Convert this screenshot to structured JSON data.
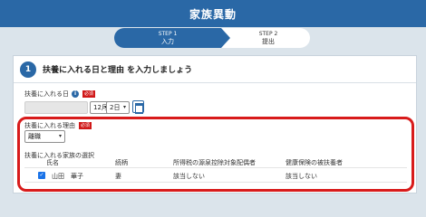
{
  "header": {
    "title": "家族異動"
  },
  "steps": [
    {
      "num": "STEP 1",
      "label": "入力"
    },
    {
      "num": "STEP 2",
      "label": "提出"
    }
  ],
  "section": {
    "number": "1",
    "title": "扶養に入れる日と理由 を入力しましょう"
  },
  "date_field": {
    "label": "扶養に入れる日",
    "required": "必須",
    "info": "i",
    "month": "12月",
    "day": "2日"
  },
  "reason_field": {
    "label": "扶養に入れる理由",
    "required": "必須",
    "value": "離職"
  },
  "family": {
    "label": "扶養に入れる家族の選択",
    "columns": [
      "氏名",
      "続柄",
      "所得税の源泉控除対象配偶者",
      "健康保険の被扶養者"
    ],
    "rows": [
      {
        "checked": "✓",
        "name": "山田　華子",
        "relation": "妻",
        "tax": "該当しない",
        "insurance": "該当しない"
      }
    ]
  },
  "colors": {
    "primary": "#2a68a6",
    "highlight": "#d81b1b",
    "required": "#d01818"
  }
}
